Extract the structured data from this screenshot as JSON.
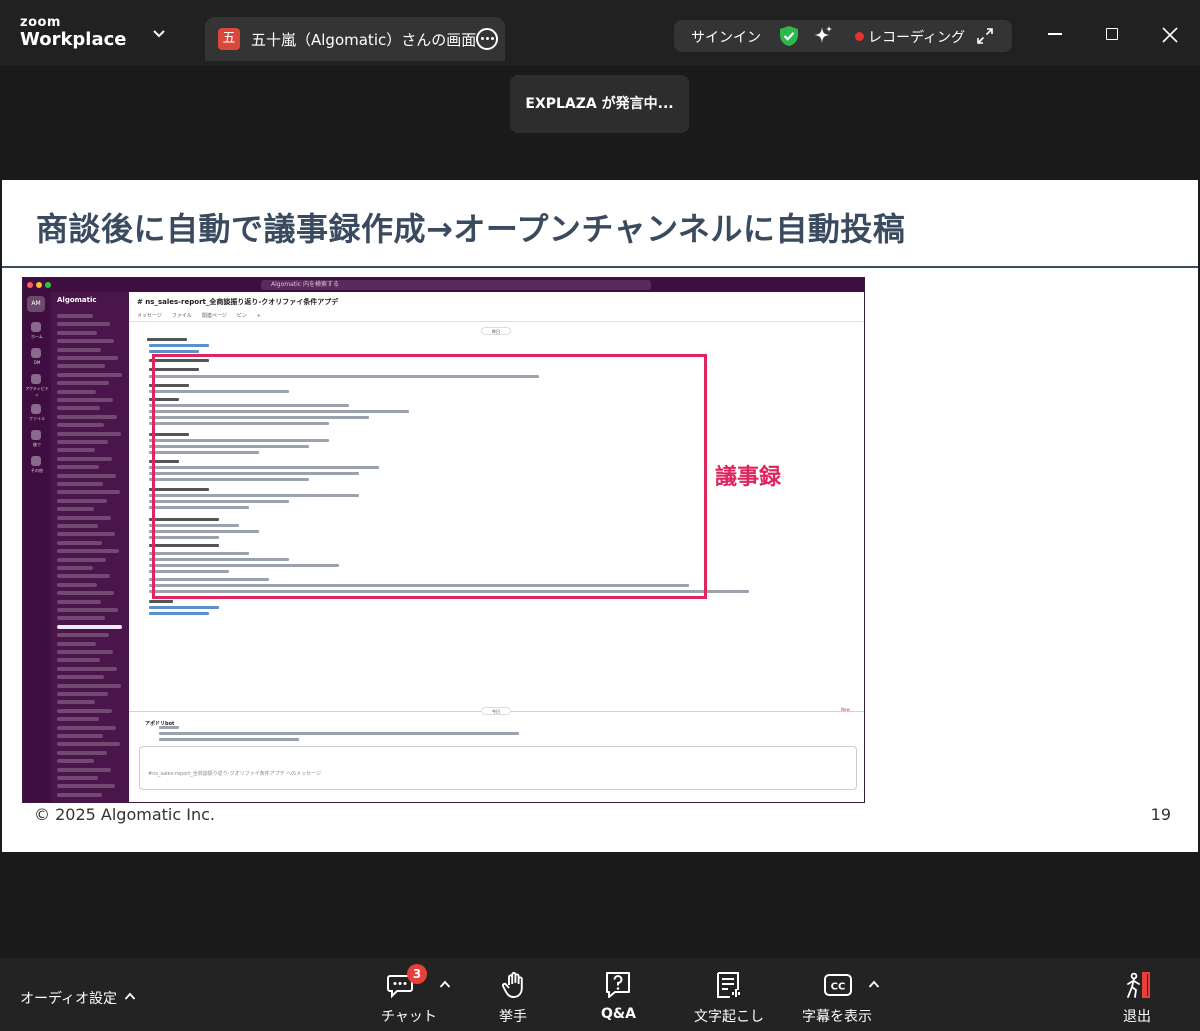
{
  "app": {
    "brand_top": "zoom",
    "brand_bottom": "Workplace",
    "meeting_tab_avatar": "五",
    "meeting_tab_title": "五十嵐（Algomatic）さんの画面",
    "signin_label": "サインイン",
    "recording_label": "レコーディング",
    "speaking_toast": "EXPLAZA が発言中...",
    "colors": {
      "accent_red": "#e5403a",
      "shield_green": "#2db84c",
      "slide_title": "#3a4a5f",
      "highlight": "#e0245e"
    }
  },
  "slide": {
    "title": "商談後に自動で議事録作成→オープンチャンネルに自動投稿",
    "annotation": "議事録",
    "footer": "© 2025 Algomatic Inc.",
    "page_number": "19"
  },
  "embedded_screenshot": {
    "search_placeholder": "Algomatic 内を検索する",
    "rail_workspace": "AM",
    "rail_labels": [
      "ホーム",
      "DM",
      "アクティビティ",
      "ファイル",
      "後で",
      "その他"
    ],
    "workspace_name": "Algomatic",
    "channel_name": "# ns_sales-report_全商談振り返り-クオリファイ条件アプデ",
    "channel_tabs": "メッセージ　　ファイル　　関連ページ　　ピン　　+",
    "date_chip": "昨日",
    "today_chip": "今日",
    "new_label": "New",
    "bot_name": "アポドリbot",
    "compose_placeholder": "#ns_sales-report_全商談振り返り-クオリファイ条件アプデ へのメッセージ"
  },
  "toolbar": {
    "audio_label": "オーディオ設定",
    "chat_label": "チャット",
    "chat_badge": "3",
    "raise_hand_label": "挙手",
    "qa_label": "Q&A",
    "transcript_label": "文字起こし",
    "captions_label": "字幕を表示",
    "leave_label": "退出"
  },
  "icons": [
    "chevron-down-icon",
    "more-icon",
    "shield-check-icon",
    "sparkle-icon",
    "record-dot-icon",
    "expand-icon",
    "minimize-icon",
    "maximize-icon",
    "close-icon",
    "chat-icon",
    "hand-icon",
    "qa-icon",
    "transcript-icon",
    "cc-icon",
    "leave-icon",
    "caret-up-icon"
  ]
}
